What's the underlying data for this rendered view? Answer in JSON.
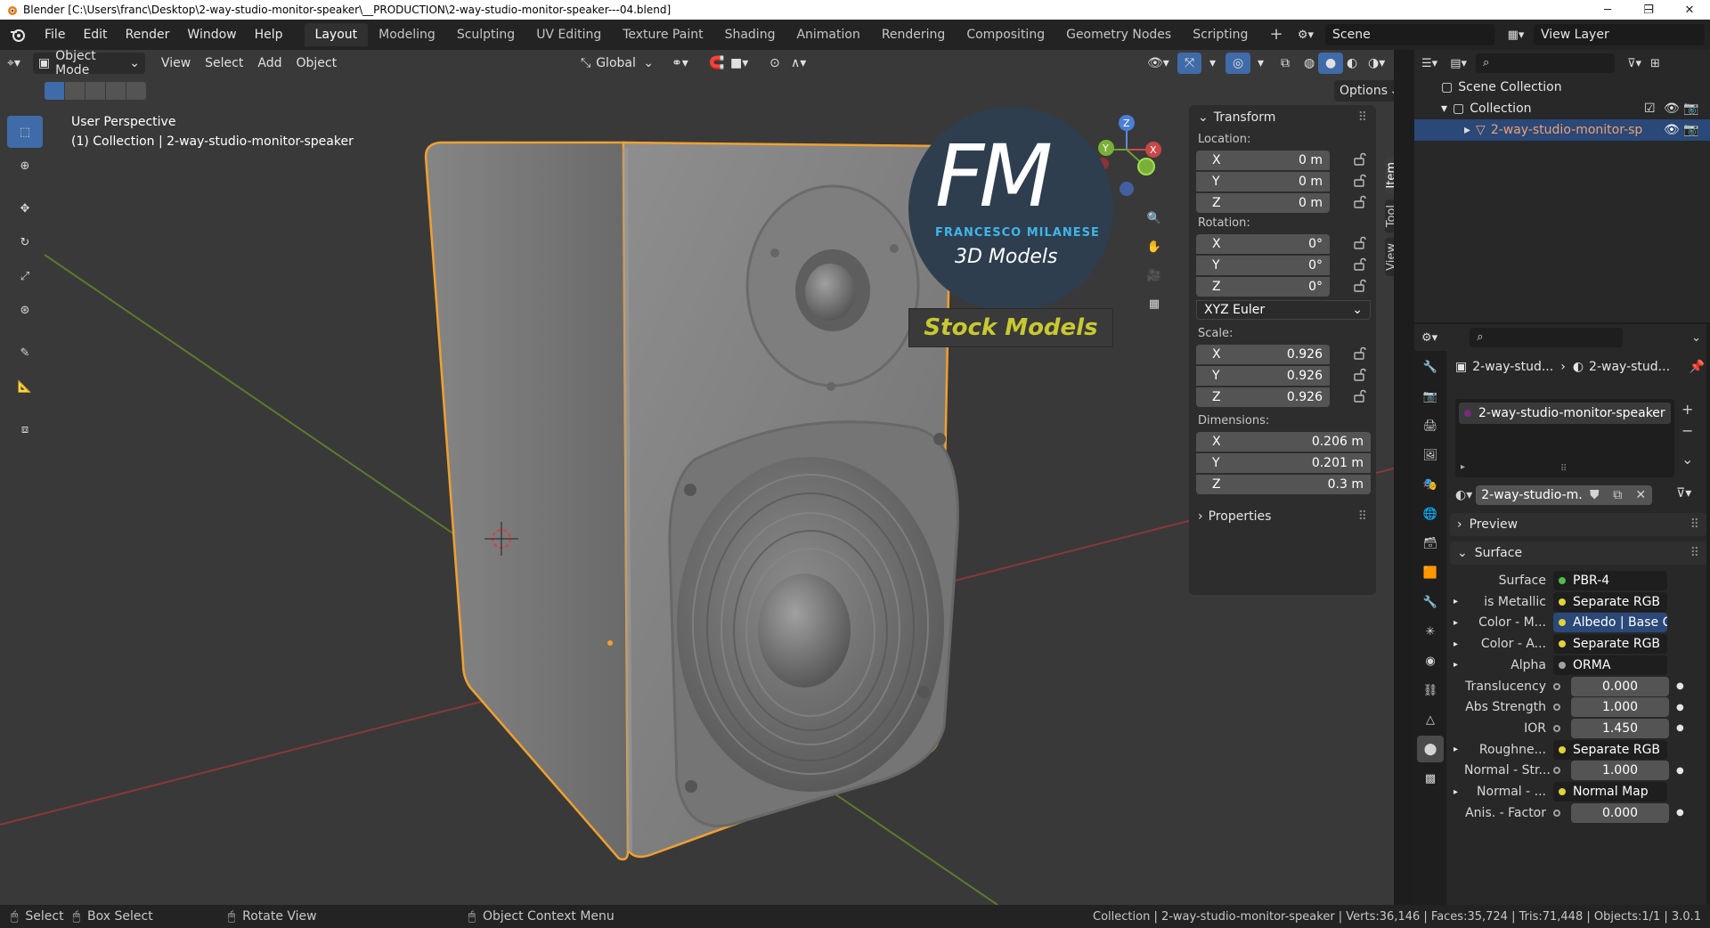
{
  "window": {
    "title": "Blender [C:\\Users\\franc\\Desktop\\2-way-studio-monitor-speaker\\__PRODUCTION\\2-way-studio-monitor-speaker---04.blend]"
  },
  "menu": [
    "File",
    "Edit",
    "Render",
    "Window",
    "Help"
  ],
  "workspaces": [
    "Layout",
    "Modeling",
    "Sculpting",
    "UV Editing",
    "Texture Paint",
    "Shading",
    "Animation",
    "Rendering",
    "Compositing",
    "Geometry Nodes",
    "Scripting"
  ],
  "active_workspace": "Layout",
  "scene": {
    "name": "Scene",
    "view_layer": "View Layer"
  },
  "viewport_header": {
    "mode": "Object Mode",
    "menus": [
      "View",
      "Select",
      "Add",
      "Object"
    ],
    "orientation": "Global",
    "options_label": "Options"
  },
  "viewport": {
    "perspective": "User Perspective",
    "collection_info": "(1) Collection | 2-way-studio-monitor-speaker"
  },
  "watermark": {
    "initials": "FM",
    "name": "FRANCESCO MILANESE",
    "sub": "3D Models",
    "banner": "Stock Models"
  },
  "npanel": {
    "tabs": [
      "Item",
      "Tool",
      "View"
    ],
    "transform_title": "Transform",
    "location_label": "Location:",
    "location": [
      {
        "axis": "X",
        "value": "0 m"
      },
      {
        "axis": "Y",
        "value": "0 m"
      },
      {
        "axis": "Z",
        "value": "0 m"
      }
    ],
    "rotation_label": "Rotation:",
    "rotation": [
      {
        "axis": "X",
        "value": "0°"
      },
      {
        "axis": "Y",
        "value": "0°"
      },
      {
        "axis": "Z",
        "value": "0°"
      }
    ],
    "rotation_mode": "XYZ Euler",
    "scale_label": "Scale:",
    "scale": [
      {
        "axis": "X",
        "value": "0.926"
      },
      {
        "axis": "Y",
        "value": "0.926"
      },
      {
        "axis": "Z",
        "value": "0.926"
      }
    ],
    "dimensions_label": "Dimensions:",
    "dimensions": [
      {
        "axis": "X",
        "value": "0.206 m"
      },
      {
        "axis": "Y",
        "value": "0.201 m"
      },
      {
        "axis": "Z",
        "value": "0.3 m"
      }
    ],
    "properties_title": "Properties"
  },
  "outliner": {
    "scene_collection": "Scene Collection",
    "collection": "Collection",
    "object": "2-way-studio-monitor-sp"
  },
  "properties": {
    "breadcrumb_obj": "2-way-stud...",
    "breadcrumb_mat": "2-way-stud...",
    "material_slot": "2-way-studio-monitor-speaker",
    "material_name": "2-way-studio-m...",
    "preview_label": "Preview",
    "surface_section": "Surface",
    "rows": [
      {
        "label": "Surface",
        "value": "PBR-4",
        "dot": "#4bbf4b",
        "kind": "link",
        "expander": false
      },
      {
        "label": "is Metallic",
        "value": "Separate RGB",
        "dot": "#e0d23a",
        "kind": "link",
        "expander": true
      },
      {
        "label": "Color - M...",
        "value": "Albedo | Base C...",
        "dot": "#e0d23a",
        "kind": "link-blue",
        "expander": true
      },
      {
        "label": "Color - A...",
        "value": "Separate RGB",
        "dot": "#e0d23a",
        "kind": "link",
        "expander": true
      },
      {
        "label": "Alpha",
        "value": "ORMA",
        "dot": "#a0a0a0",
        "kind": "link",
        "expander": true
      },
      {
        "label": "Translucency",
        "value": "0.000",
        "dot": "#a0a0a0",
        "kind": "num",
        "expander": false
      },
      {
        "label": "Abs Strength",
        "value": "1.000",
        "dot": "#a0a0a0",
        "kind": "num",
        "expander": false
      },
      {
        "label": "IOR",
        "value": "1.450",
        "dot": "#a0a0a0",
        "kind": "num",
        "expander": false
      },
      {
        "label": "Roughne...",
        "value": "Separate RGB",
        "dot": "#e0d23a",
        "kind": "link",
        "expander": true
      },
      {
        "label": "Normal - Str...",
        "value": "1.000",
        "dot": "#a0a0a0",
        "kind": "num",
        "expander": false
      },
      {
        "label": "Normal - ...",
        "value": "Normal Map",
        "dot": "#e0d23a",
        "kind": "link",
        "expander": true
      },
      {
        "label": "Anis. - Factor",
        "value": "0.000",
        "dot": "#a0a0a0",
        "kind": "num",
        "expander": false
      }
    ]
  },
  "statusbar": {
    "select": "Select",
    "box_select": "Box Select",
    "rotate": "Rotate View",
    "context": "Object Context Menu",
    "stats": "Collection | 2-way-studio-monitor-speaker | Verts:36,146 | Faces:35,724 | Tris:71,448 | Objects:1/1 | 3.0.1"
  },
  "colors": {
    "accent": "#3f6ba8",
    "selection_outline": "#f0a030",
    "watermark_blue": "#3fb6e8",
    "watermark_banner": "#c8c832"
  }
}
